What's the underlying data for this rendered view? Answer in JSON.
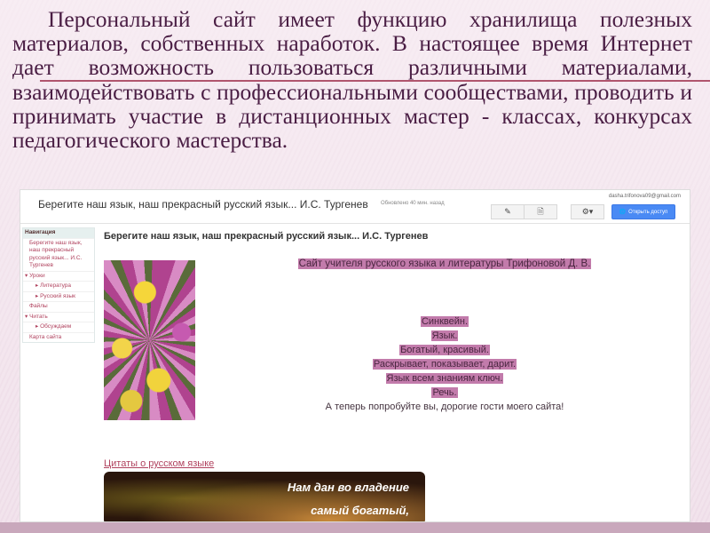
{
  "slide": {
    "paragraph": "Персональный сайт имеет функцию хранилища полезных материалов, собственных наработок. В настоящее время Интернет дает возможность пользоваться различными материалами, взаимодействовать с профессиональными сообществами, проводить и принимать участие в дистанционных мастер - классах, конкурсах педагогического мастерства."
  },
  "site": {
    "title": "Берегите наш язык, наш прекрасный русский язык... И.С. Тургенев",
    "updated": "Обновлено 40 мин. назад",
    "email": "dasha.trifonova09@gmail.com",
    "share_label": "Открыть доступ",
    "nav": {
      "heading": "Навигация",
      "items": [
        "Берегите наш язык, наш прекрасный русский язык... И.С. Тургенев",
        "Уроки",
        "Литература",
        "Русский язык",
        "Файлы",
        "Читать",
        "Обсуждаем",
        "Карта сайта"
      ]
    },
    "page_heading": "Берегите наш язык, наш прекрасный русский язык... И.С. Тургенев",
    "subtitle": "Сайт учителя русского языка и литературы Трифоновой Д. В.",
    "poem": [
      "Синквейн.",
      "Язык.",
      "Богатый, красивый.",
      "Раскрывает, показывает, дарит.",
      "Язык всем знаниям ключ.",
      "Речь."
    ],
    "invite": "А теперь попробуйте вы, дорогие гости моего сайта!",
    "quote_link": "Цитаты о русском языке",
    "quote_lines": [
      "Нам дан во владение",
      "самый богатый,"
    ]
  }
}
